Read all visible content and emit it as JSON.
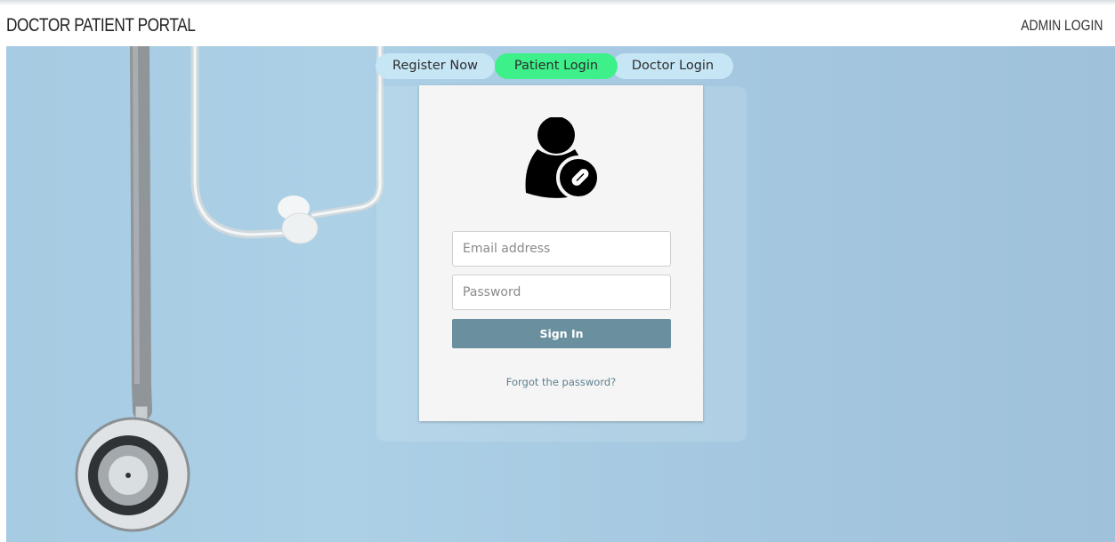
{
  "header": {
    "brand": "DOCTOR PATIENT PORTAL",
    "admin_login": "ADMIN LOGIN"
  },
  "tabs": [
    {
      "label": "Register Now",
      "active": false
    },
    {
      "label": "Patient Login",
      "active": true
    },
    {
      "label": "Doctor Login",
      "active": false
    }
  ],
  "login_form": {
    "avatar_icon": "user-pill-icon",
    "email_placeholder": "Email address",
    "password_placeholder": "Password",
    "signin_label": "Sign In",
    "forgot_link": "Forgot the password?"
  },
  "colors": {
    "active_tab": "#3df08a",
    "inactive_tab": "#c6e6f6",
    "signin_button": "#6a909f",
    "background": "#a6cbe2"
  }
}
